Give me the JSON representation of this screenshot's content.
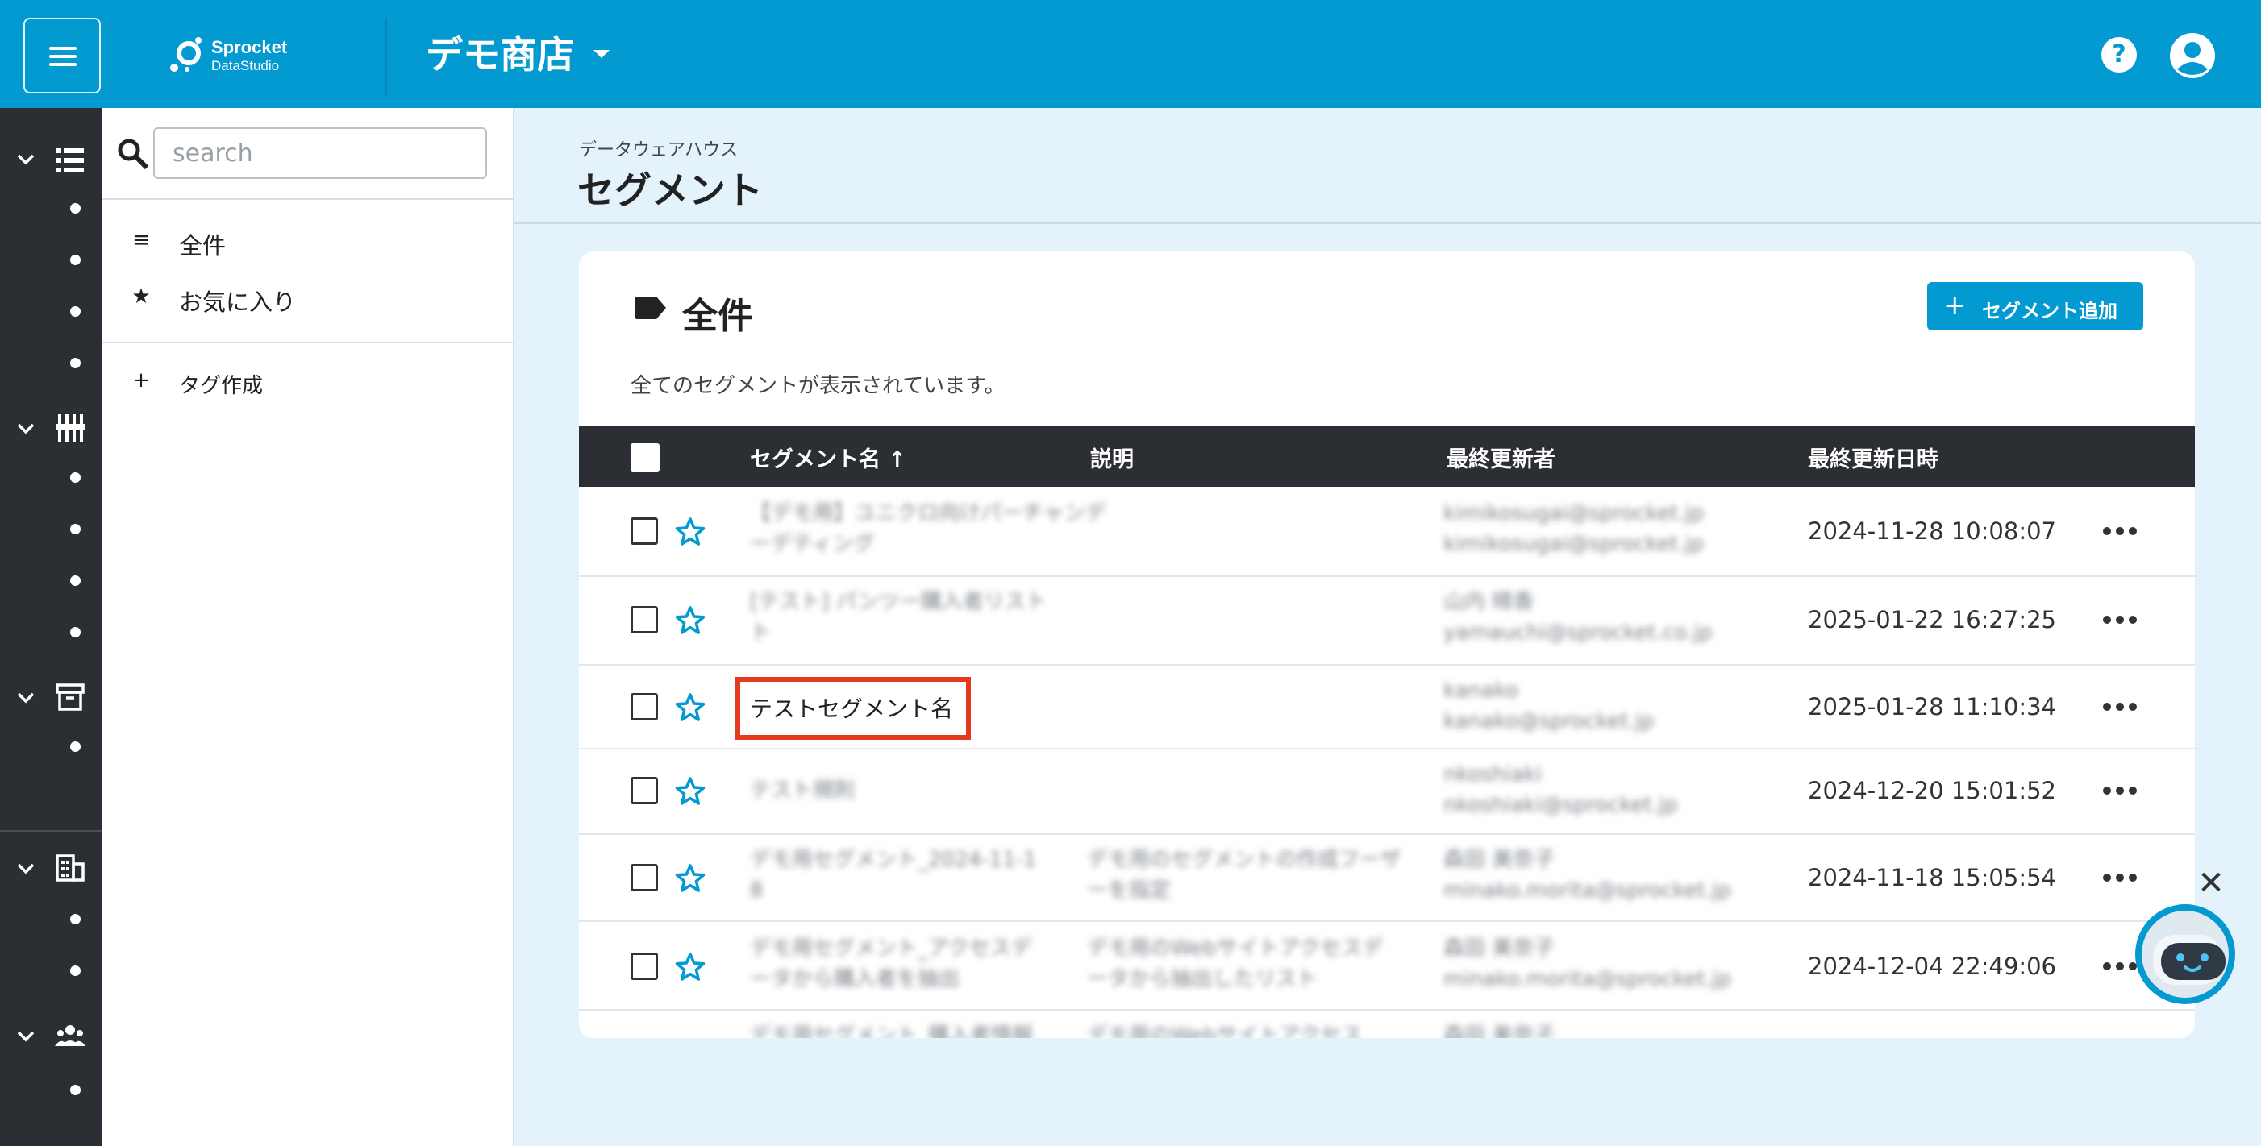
{
  "header": {
    "logo_line1": "Sprocket",
    "logo_line2": "DataStudio",
    "store_name": "デモ商店",
    "help_glyph": "?",
    "brand_color": "#0399d1"
  },
  "rail": {
    "icons": [
      "list-icon",
      "sliders-icon",
      "archive-icon",
      "building-icon",
      "people-icon"
    ]
  },
  "sidebar": {
    "search_placeholder": "search",
    "items": [
      {
        "icon": "≡",
        "label": "全件"
      },
      {
        "icon": "★",
        "label": "お気に入り"
      }
    ],
    "create_tag": {
      "icon": "+",
      "label": "タグ作成"
    }
  },
  "main": {
    "breadcrumb": "データウェアハウス",
    "title": "セグメント"
  },
  "card": {
    "title": "全件",
    "add_button": {
      "icon": "+",
      "label": "セグメント追加"
    },
    "description": "全てのセグメントが表示されています。",
    "columns": [
      "セグメント名 ↑",
      "説明",
      "最終更新者",
      "最終更新日時"
    ],
    "rows": [
      {
        "name": "【デモ用】ユニクロ向けパーチャンデ",
        "name2": "ーデティング",
        "desc": "",
        "desc2": "",
        "updater": "kimikosugai@sprocket.jp",
        "updater2": "kimikosugai@sprocket.jp",
        "date": "2024-11-28 10:08:07"
      },
      {
        "name": "[テスト] パンツー購入者リスト",
        "name2": "ト",
        "desc": "",
        "desc2": "",
        "updater": "山内 晴香",
        "updater2": "yamauchi@sprocket.co.jp",
        "date": "2025-01-22 16:27:25"
      },
      {
        "name": "テストセグメント名",
        "name2": "",
        "desc": "",
        "desc2": "",
        "updater": "kanako",
        "updater2": "kanako@sprocket.jp",
        "date": "2025-01-28 11:10:34"
      },
      {
        "name": "テスト規則",
        "name2": "",
        "desc": "",
        "desc2": "",
        "updater": "nkoshiaki",
        "updater2": "nkoshiaki@sprocket.jp",
        "date": "2024-12-20 15:01:52"
      },
      {
        "name": "デモ用セグメント_2024-11-1",
        "name2": "8",
        "desc": "デモ用のセグメントの作成フーザ",
        "desc2": "ーを指定",
        "updater": "森田 美奈子",
        "updater2": "minako.morita@sprocket.jp",
        "date": "2024-11-18 15:05:54"
      },
      {
        "name": "デモ用セグメント_アクセスデ",
        "name2": "ータから購入者を抽出",
        "desc": "デモ用のWebサイトアクセスデ",
        "desc2": "ータから抽出したリスト",
        "updater": "森田 美奈子",
        "updater2": "minako.morita@sprocket.jp",
        "date": "2024-12-04 22:49:06"
      },
      {
        "name": "デモ用セグメント_購入者情報",
        "name2": "",
        "desc": "デモ用のWebサイトアクセス",
        "desc2": "",
        "updater": "森田 美奈子",
        "updater2": "",
        "date": ""
      }
    ]
  },
  "chatbot": {
    "close_glyph": "✕"
  }
}
